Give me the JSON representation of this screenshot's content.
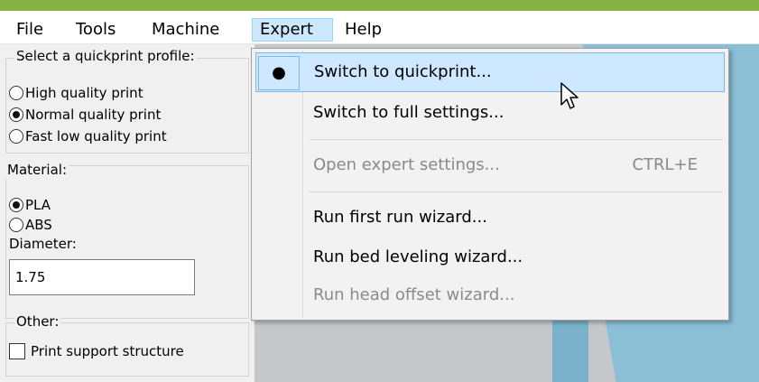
{
  "menubar": {
    "items": [
      "File",
      "Tools",
      "Machine",
      "Expert",
      "Help"
    ]
  },
  "quickprint": {
    "title": "Select a quickprint profile:",
    "options": [
      "High quality print",
      "Normal quality print",
      "Fast low quality print"
    ],
    "selected": "Normal quality print"
  },
  "material": {
    "title": "Material:",
    "options": [
      "PLA",
      "ABS"
    ],
    "selected": "PLA",
    "diameter_label": "Diameter:",
    "diameter_value": "1.75"
  },
  "other": {
    "title": "Other:",
    "support_label": "Print support structure"
  },
  "expert_menu": {
    "switch_quickprint": "Switch to quickprint...",
    "switch_full": "Switch to full settings...",
    "open_expert": "Open expert settings...",
    "open_expert_shortcut": "CTRL+E",
    "first_run_wizard": "Run first run wizard...",
    "bed_leveling_wizard": "Run bed leveling wizard...",
    "head_offset_wizard": "Run head offset wizard...",
    "bullet": "●"
  },
  "colors": {
    "accent_bar": "#86b443",
    "highlight": "#cde8ff"
  }
}
